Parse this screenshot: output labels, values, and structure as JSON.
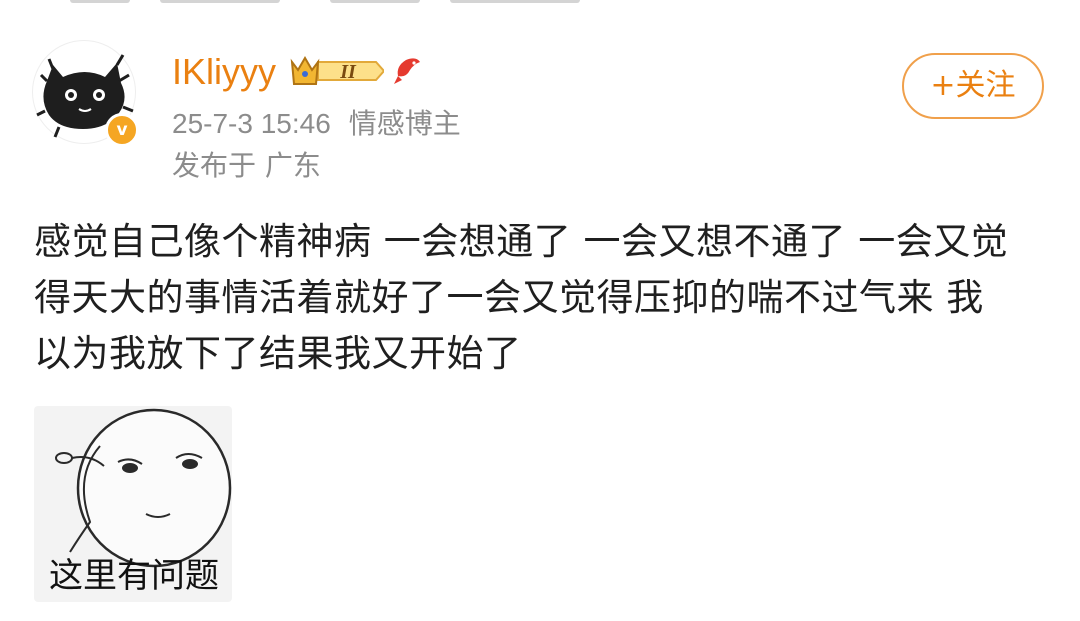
{
  "post": {
    "username": "IKliyyy",
    "vip_level": "II",
    "time": "25-7-3 15:46",
    "tag": "情感博主",
    "location": "发布于 广东",
    "follow_label": "+关注",
    "verified_mark": "v",
    "text_lines": [
      "感觉自己像个精神病 一会想通了 一会又想不通了 一会又觉",
      "得天大的事情活着就好了一会又觉得压抑的喘不过气来 我",
      "以为我放下了结果我又开始了"
    ],
    "sticker_caption": "这里有问题"
  },
  "icons": {
    "avatar": "black-cat-avatar",
    "verified": "verified-v-icon",
    "vip": "crown-vip-icon",
    "fish": "red-fish-icon"
  },
  "colors": {
    "username": "#ea8011",
    "meta": "#8c8c8c",
    "follow_border": "#f0a04b",
    "verified_badge": "#f5a623",
    "text": "#1f1f1f"
  }
}
